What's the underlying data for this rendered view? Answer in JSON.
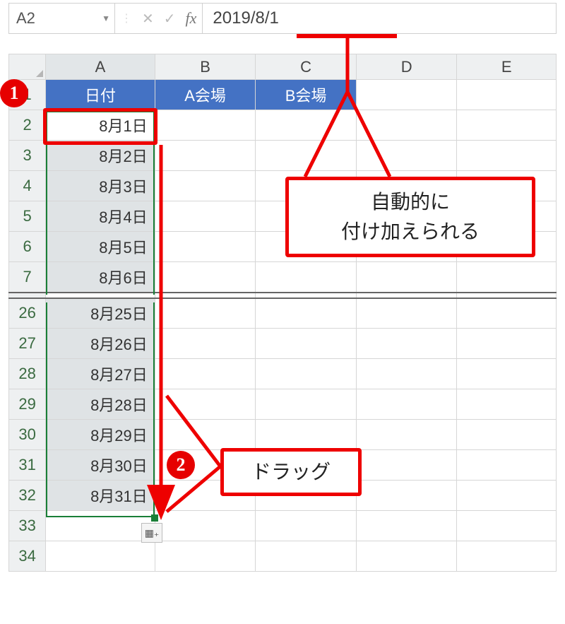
{
  "formula_bar": {
    "name_box": "A2",
    "value": "2019/8/1",
    "fx_label": "fx"
  },
  "columns": [
    "A",
    "B",
    "C",
    "D",
    "E"
  ],
  "header_row": {
    "rownum": "1",
    "A": "日付",
    "B": "A会場",
    "C": "B会場"
  },
  "rows_top": [
    {
      "rownum": "2",
      "A": "8月1日"
    },
    {
      "rownum": "3",
      "A": "8月2日"
    },
    {
      "rownum": "4",
      "A": "8月3日"
    },
    {
      "rownum": "5",
      "A": "8月4日"
    },
    {
      "rownum": "6",
      "A": "8月5日"
    },
    {
      "rownum": "7",
      "A": "8月6日"
    }
  ],
  "rows_bottom": [
    {
      "rownum": "26",
      "A": "8月25日"
    },
    {
      "rownum": "27",
      "A": "8月26日"
    },
    {
      "rownum": "28",
      "A": "8月27日"
    },
    {
      "rownum": "29",
      "A": "8月28日"
    },
    {
      "rownum": "30",
      "A": "8月29日"
    },
    {
      "rownum": "31",
      "A": "8月30日"
    },
    {
      "rownum": "32",
      "A": "8月31日"
    }
  ],
  "rows_empty": [
    {
      "rownum": "33"
    },
    {
      "rownum": "34"
    }
  ],
  "callouts": {
    "auto_line1": "自動的に",
    "auto_line2": "付け加えられる",
    "drag": "ドラッグ"
  },
  "badges": {
    "b1": "1",
    "b2": "2"
  },
  "autofill_btn_glyph": "▦₊"
}
